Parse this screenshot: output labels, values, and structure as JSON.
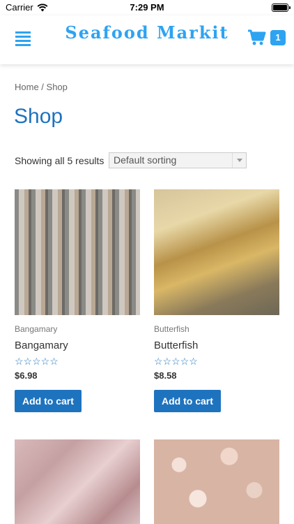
{
  "status": {
    "carrier": "Carrier",
    "time": "7:29 PM"
  },
  "header": {
    "logo": "Seafood Markit",
    "cart_count": "1"
  },
  "breadcrumb": {
    "home": "Home",
    "separator": " / ",
    "current": "Shop"
  },
  "page_title": "Shop",
  "results_text": "Showing all 5 results",
  "sort": {
    "selected": "Default sorting"
  },
  "products": [
    {
      "category": "Bangamary",
      "name": "Bangamary",
      "rating": "☆☆☆☆☆",
      "price": "$6.98",
      "button": "Add to cart"
    },
    {
      "category": "Butterfish",
      "name": "Butterfish",
      "rating": "☆☆☆☆☆",
      "price": "$8.58",
      "button": "Add to cart"
    }
  ],
  "colors": {
    "accent": "#2ea3f2",
    "primary": "#1e73be"
  },
  "icons": {
    "menu": "menu-icon",
    "cart": "cart-icon",
    "wifi": "wifi-icon",
    "battery": "battery-icon"
  }
}
